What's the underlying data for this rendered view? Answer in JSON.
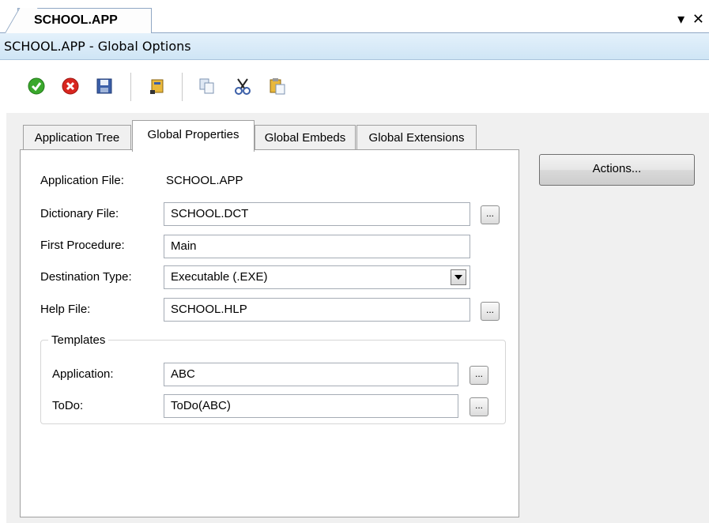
{
  "document_tab": {
    "label": "SCHOOL.APP"
  },
  "window_controls": {
    "dropdown": "▾",
    "close": "✕"
  },
  "title": "SCHOOL.APP - Global Options",
  "toolbar": {
    "icons": [
      "ok-icon",
      "cancel-icon",
      "save-icon",
      "properties-icon",
      "copy-icon",
      "cut-icon",
      "paste-icon"
    ]
  },
  "tabs": {
    "application_tree": "Application Tree",
    "global_properties": "Global Properties",
    "global_embeds": "Global Embeds",
    "global_extensions": "Global Extensions"
  },
  "form": {
    "application_file": {
      "label": "Application File:",
      "value": "SCHOOL.APP"
    },
    "dictionary_file": {
      "label": "Dictionary File:",
      "value": "SCHOOL.DCT"
    },
    "first_procedure": {
      "label": "First Procedure:",
      "value": "Main"
    },
    "destination_type": {
      "label": "Destination Type:",
      "value": "Executable (.EXE)"
    },
    "help_file": {
      "label": "Help File:",
      "value": "SCHOOL.HLP"
    },
    "browse_label": "...",
    "templates": {
      "title": "Templates",
      "application": {
        "label": "Application:",
        "value": "ABC"
      },
      "todo": {
        "label": "ToDo:",
        "value": "ToDo(ABC)"
      }
    }
  },
  "actions_button": "Actions...",
  "colors": {
    "titlebar": "#d7eaf8",
    "panel": "#f0f0f0",
    "ok_green": "#3aa82c",
    "cancel_red": "#d8261f"
  }
}
